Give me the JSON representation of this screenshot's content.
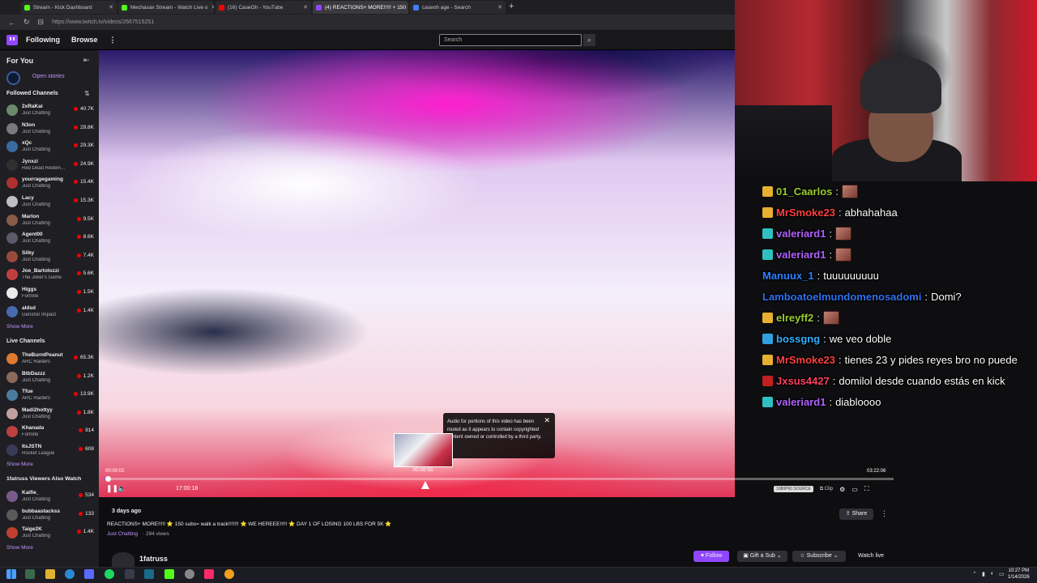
{
  "browser": {
    "tabs": [
      {
        "label": "Stream - Kick Dashboard",
        "color": "#53fc18"
      },
      {
        "label": "Mechasax Stream - Watch Live o",
        "color": "#53fc18"
      },
      {
        "label": "(16) CaseOh - YouTube",
        "color": "#ff0000"
      },
      {
        "label": "(4) REACTIONS+ MORE!!!!! + 150",
        "color": "#9147ff"
      },
      {
        "label": "caseoh age - Search",
        "color": "#3b82f6"
      }
    ],
    "url": "https://www.twitch.tv/videos/2667515251"
  },
  "topnav": {
    "following": "Following",
    "browse": "Browse",
    "more": "⋮",
    "search_placeholder": "Search"
  },
  "sidebar": {
    "for_you": "For You",
    "open_stories": "Open stories",
    "followed_header": "Followed Channels",
    "followed": [
      {
        "name": "2xRaKai",
        "game": "Just Chatting",
        "viewers": "40.7K",
        "color": "#6a8a6a"
      },
      {
        "name": "N3on",
        "game": "Just Chatting",
        "viewers": "29.8K",
        "color": "#7a7a7a"
      },
      {
        "name": "xQc",
        "game": "Just Chatting",
        "viewers": "29.3K",
        "color": "#3a6aa0"
      },
      {
        "name": "Jynxzi",
        "game": "Red Dead Redem...",
        "viewers": "24.9K",
        "color": "#303030"
      },
      {
        "name": "yourragegaming",
        "game": "Just Chatting",
        "viewers": "15.4K",
        "color": "#b03030"
      },
      {
        "name": "Lacy",
        "game": "Just Chatting",
        "viewers": "15.3K",
        "color": "#c0c0c0"
      },
      {
        "name": "Marlon",
        "game": "Just Chatting",
        "viewers": "9.5K",
        "color": "#8a5a4a"
      },
      {
        "name": "Agent00",
        "game": "Just Chatting",
        "viewers": "8.6K",
        "color": "#5a5a6a"
      },
      {
        "name": "Silky",
        "game": "Just Chatting",
        "viewers": "7.4K",
        "color": "#9a4a3a"
      },
      {
        "name": "Joe_Bartolozzi",
        "game": "The Joker's Game",
        "viewers": "5.6K",
        "color": "#c04040"
      },
      {
        "name": "Higgs",
        "game": "Fortnite",
        "viewers": "1.5K",
        "color": "#eaeaea"
      },
      {
        "name": "aldsd",
        "game": "Genshin Impact",
        "viewers": "1.4K",
        "color": "#4a6ab0"
      }
    ],
    "show_more": "Show More",
    "live_header": "Live Channels",
    "live": [
      {
        "name": "TheBurntPeanut",
        "game": "ARC Raiders",
        "viewers": "65.3K",
        "color": "#e07a30"
      },
      {
        "name": "BtbDazzz",
        "game": "Just Chatting",
        "viewers": "1.2K",
        "color": "#8a6a5a"
      },
      {
        "name": "Tfue",
        "game": "ARC Raiders",
        "viewers": "13.9K",
        "color": "#4a7aa0"
      },
      {
        "name": "Madi2hottyy",
        "game": "Just Chatting",
        "viewers": "1.8K",
        "color": "#c0a0a0"
      },
      {
        "name": "Khanada",
        "game": "Fortnite",
        "viewers": "914",
        "color": "#c04040"
      },
      {
        "name": "ItsJSTN",
        "game": "Rocket League",
        "viewers": "608",
        "color": "#3a3a5a"
      }
    ],
    "also_header": "1fatruss Viewers Also Watch",
    "also": [
      {
        "name": "Kaifie_",
        "game": "Just Chatting",
        "viewers": "534",
        "color": "#7a5a8a"
      },
      {
        "name": "bubbaastackss",
        "game": "Just Chatting",
        "viewers": "133",
        "color": "#5a5a5a"
      },
      {
        "name": "Taige2K",
        "game": "Just Chatting",
        "viewers": "1.4K",
        "color": "#c04030"
      }
    ]
  },
  "video": {
    "muted_notice": "Audio for portions of this video has been muted as it appears to contain copyrighted content owned or controlled by a third party.",
    "hover_time": "00:08:55",
    "time_left": "00:00:02",
    "time_right": "03:22:06",
    "current_time": "17:00:18",
    "quality_label": "1080P60 SOURCE",
    "clip_label": "Clip",
    "progress": 0.004
  },
  "details": {
    "ago": "3 days ago",
    "title": "REACTIONS+ MORE!!!!! ⭐ 150 subs= walk a track!!!!!!! ⭐ WE HEREEE!!!!! ⭐ DAY 1 OF LOSING 100 LBS FOR 5K ⭐",
    "category": "Just Chatting",
    "views": "· 294 views",
    "channel": "1fatruss",
    "share": "Share",
    "follow": "♥ Follow",
    "gift": "Gift a Sub",
    "subscribe": "Subscribe",
    "watch_live": "Watch live"
  },
  "chat": [
    {
      "user": "01_Caarlos",
      "color": "#9acd32",
      "text": "",
      "emote": true,
      "badge": "#e8b030"
    },
    {
      "user": "MrSmoke23",
      "color": "#ff4040",
      "text": "abhahahaa",
      "emote": false,
      "badge": "#e8b030"
    },
    {
      "user": "valeriard1",
      "color": "#b060ff",
      "text": "",
      "emote": true,
      "badge": "#30c0c0"
    },
    {
      "user": "valeriard1",
      "color": "#b060ff",
      "text": "",
      "emote": true,
      "badge": "#30c0c0"
    },
    {
      "user": "Manuux_1",
      "color": "#3080ff",
      "text": "tuuuuuuuuu",
      "emote": false,
      "badge": ""
    },
    {
      "user": "Lamboatoelmundomenosadomi",
      "color": "#3070f0",
      "text": "Domi?",
      "emote": false,
      "badge": ""
    },
    {
      "user": "elreyff2",
      "color": "#9acd32",
      "text": "",
      "emote": true,
      "badge": "#e8b030"
    },
    {
      "user": "bossgng",
      "color": "#30b0ff",
      "text": "we veo doble",
      "emote": false,
      "badge": "#30a0e0"
    },
    {
      "user": "MrSmoke23",
      "color": "#ff4040",
      "text": "tienes 23 y pides reyes bro no puede",
      "emote": false,
      "badge": "#e8b030"
    },
    {
      "user": "Jxsus4427",
      "color": "#ff4060",
      "text": "domilol desde cuando estás en kick",
      "emote": false,
      "badge": "#c02020"
    },
    {
      "user": "valeriard1",
      "color": "#b060ff",
      "text": "diabloooo",
      "emote": false,
      "badge": "#30c0c0"
    }
  ],
  "taskbar": {
    "time": "10:27 PM",
    "date": "1/14/2026"
  }
}
